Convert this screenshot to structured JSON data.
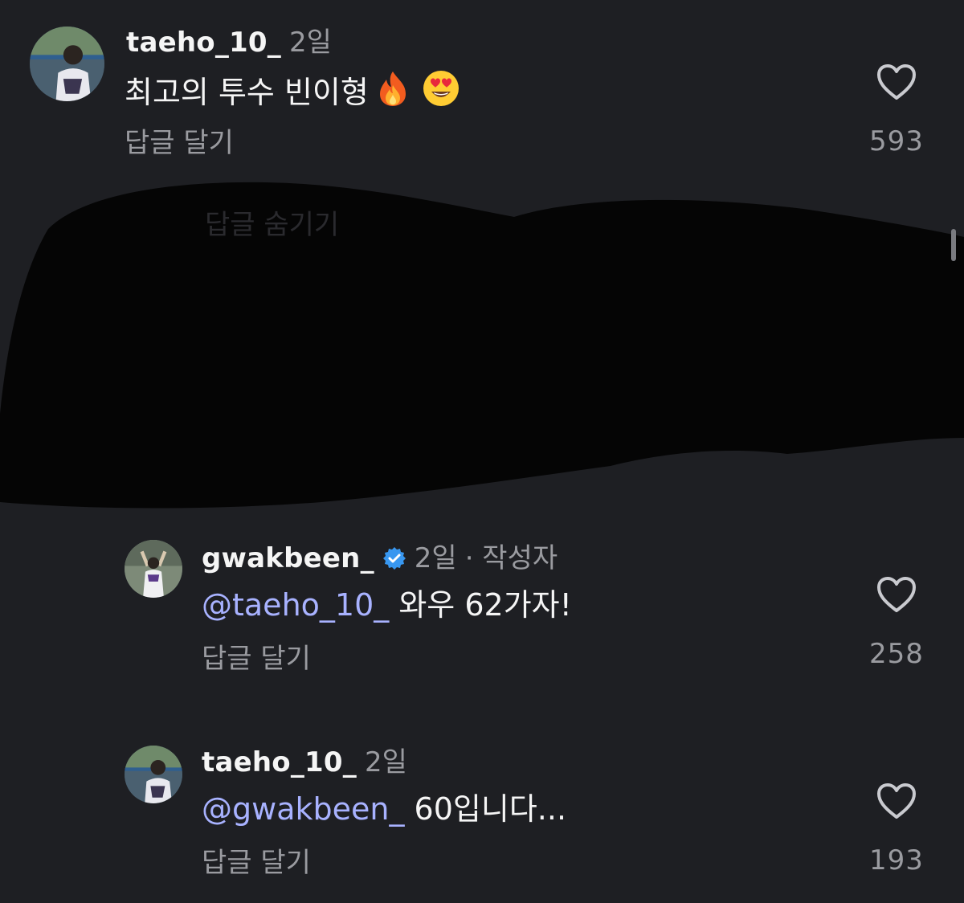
{
  "comments": [
    {
      "username": "taeho_10_",
      "time": "2일",
      "text": "최고의 투수 빈이형",
      "emojis": [
        "fire-emoji",
        "heart-eyes-emoji"
      ],
      "reply_label": "답글 달기",
      "likes": "593",
      "verified": false
    },
    {
      "username": "gwakbeen_",
      "time": "2일",
      "author_tag": "· 작성자",
      "mention": "@taeho_10_",
      "text": " 와우 62가자!",
      "reply_label": "답글 달기",
      "likes": "258",
      "verified": true
    },
    {
      "username": "taeho_10_",
      "time": "2일",
      "mention": "@gwakbeen_",
      "text": " 60입니다...",
      "reply_label": "답글 달기",
      "likes": "193",
      "verified": false
    }
  ],
  "hidden_section": {
    "label": "답글 숨기기"
  },
  "colors": {
    "background": "#1e1f23",
    "text": "#f5f5f5",
    "secondary": "#9a9ba0",
    "mention": "#a8b2ff",
    "verified": "#3897f0",
    "redaction": "#050505"
  }
}
